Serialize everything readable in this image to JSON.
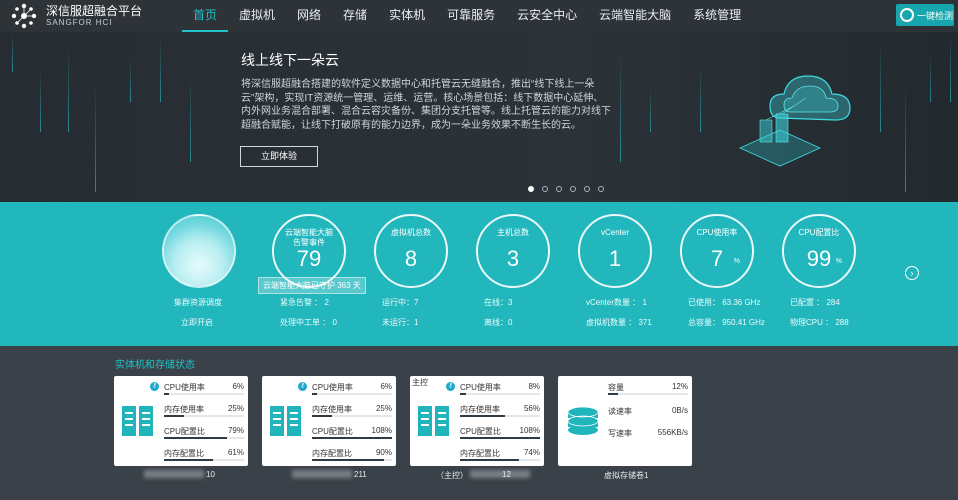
{
  "app": {
    "title": "深信服超融合平台",
    "subtitle": "SANGFOR HCI"
  },
  "nav": {
    "items": [
      "首页",
      "虚拟机",
      "网络",
      "存储",
      "实体机",
      "可靠服务",
      "云安全中心",
      "云端智能大脑",
      "系统管理"
    ],
    "active_index": 0,
    "detect_label": "一键检测"
  },
  "banner": {
    "title": "线上线下一朵云",
    "description": "将深信服超融合搭建的软件定义数据中心和托管云无缝融合，推出“线下线上一朵云”架构，实现IT资源统一管理、运维、运营。核心场景包括：线下数据中心延伸、内外网业务混合部署、混合云容灾备份、集团分支托管等。线上托管云的能力对线下超融合赋能，让线下打破原有的能力边界，成为一朵业务效果不断生长的云。",
    "button_label": "立即体验",
    "slide_count": 6,
    "active_slide": 0
  },
  "stats": {
    "cluster": {
      "label": "集群资源调度",
      "action": "立即开启"
    },
    "brain": {
      "label": "云端智能大脑",
      "label2": "告警事件",
      "value": "79",
      "tooltip": "云端智能大脑已守护 363 天",
      "line1": "紧急告警 ： 2",
      "line2": "处理中工单 ： 0"
    },
    "vm": {
      "label": "虚拟机总数",
      "value": "8",
      "line1": "运行中：7",
      "line2": "未运行：1"
    },
    "host": {
      "label": "主机总数",
      "value": "3",
      "line1": "在线：3",
      "line2": "离线：0"
    },
    "vcenter": {
      "label": "vCenter",
      "value": "1",
      "line1": "vCenter数量 ： 1",
      "line2": "虚拟机数量 ： 371"
    },
    "cpu_usage": {
      "label": "CPU使用率",
      "value": "7",
      "unit": "%",
      "line1": "已使用： 63.36 GHz",
      "line2": "总容量： 950.41 GHz"
    },
    "cpu_config": {
      "label": "CPU配置比",
      "value": "99",
      "unit": "%",
      "line1": "已配置 ： 284",
      "line2": "物理CPU ： 288"
    }
  },
  "section": {
    "title": "实体机和存储状态"
  },
  "hosts": [
    {
      "name": "10",
      "prefix": "",
      "metrics": [
        {
          "label": "CPU使用率",
          "value": "6%",
          "pct": 6
        },
        {
          "label": "内存使用率",
          "value": "25%",
          "pct": 25
        },
        {
          "label": "CPU配置比",
          "value": "79%",
          "pct": 79
        },
        {
          "label": "内存配置比",
          "value": "61%",
          "pct": 61
        }
      ]
    },
    {
      "name": "211",
      "prefix": "",
      "metrics": [
        {
          "label": "CPU使用率",
          "value": "6%",
          "pct": 6
        },
        {
          "label": "内存使用率",
          "value": "25%",
          "pct": 25
        },
        {
          "label": "CPU配置比",
          "value": "108%",
          "pct": 100
        },
        {
          "label": "内存配置比",
          "value": "90%",
          "pct": 90
        }
      ]
    },
    {
      "name": "12",
      "prefix": "（主控）",
      "tag": "主控",
      "metrics": [
        {
          "label": "CPU使用率",
          "value": "8%",
          "pct": 8
        },
        {
          "label": "内存使用率",
          "value": "56%",
          "pct": 56
        },
        {
          "label": "CPU配置比",
          "value": "108%",
          "pct": 100
        },
        {
          "label": "内存配置比",
          "value": "74%",
          "pct": 74
        }
      ]
    }
  ],
  "storage": {
    "name": "虚拟存储卷1",
    "capacity_label": "容量",
    "capacity_value": "12%",
    "capacity_pct": 12,
    "read_label": "读速率",
    "read_value": "0B/s",
    "write_label": "写速率",
    "write_value": "556KB/s"
  }
}
